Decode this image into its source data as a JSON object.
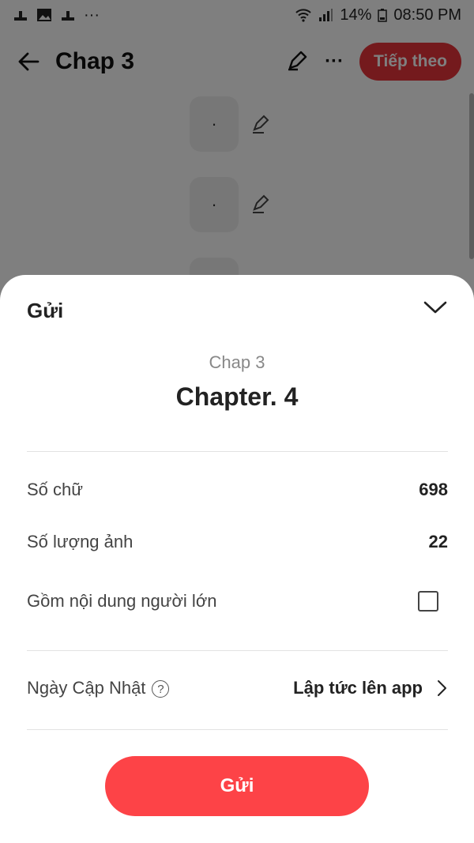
{
  "status_bar": {
    "time": "08:50 PM",
    "battery": "14%",
    "more": "···"
  },
  "app_bar": {
    "title": "Chap 3",
    "next_label": "Tiếp theo",
    "more": "···"
  },
  "content": {
    "tiles": [
      "·",
      "·"
    ]
  },
  "sheet": {
    "title": "Gửi",
    "subtitle": "Chap 3",
    "chapter_title": "Chapter. 4",
    "word_count_label": "Số chữ",
    "word_count_value": "698",
    "image_count_label": "Số lượng ảnh",
    "image_count_value": "22",
    "adult_label": "Gồm nội dung người lớn",
    "adult_checked": false,
    "update_label": "Ngày Cập Nhật",
    "help_symbol": "?",
    "update_value": "Lập tức lên app",
    "submit_label": "Gửi"
  },
  "colors": {
    "accent": "#fd4347",
    "next_button": "#e8353b"
  }
}
